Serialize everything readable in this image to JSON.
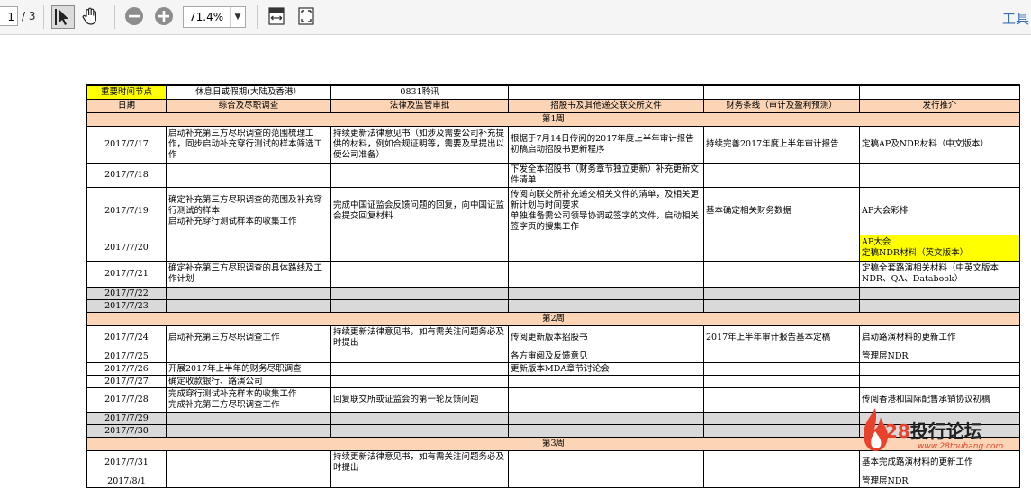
{
  "toolbar": {
    "page_current": "1",
    "page_total": "/ 3",
    "zoom": "71.4%",
    "tools": "工具",
    "icons": [
      "select-arrow-icon",
      "hand-icon",
      "zoom-out-icon",
      "zoom-in-icon",
      "fit-width-icon",
      "fit-page-icon"
    ]
  },
  "sheet": {
    "top": {
      "key_dates_label": "重要时间节点",
      "holiday": "休息日或假期(大陆及香港）",
      "hearing": "0831聆讯"
    },
    "headers": [
      "日期",
      "综合及尽职调查",
      "法律及监管审批",
      "招股书及其他递交联交所文件",
      "财务条线（审计及盈利预测）",
      "发行推介"
    ],
    "weeks": [
      "第1周",
      "第2周",
      "第3周"
    ],
    "rows": [
      {
        "date": "2017/7/17",
        "c1": "启动补充第三方尽职调查的范围梳理工作，同步启动补充穿行测试的样本筛选工作",
        "c2": "持续更新法律意见书（如涉及需要公司补充提供的材料，例如合规证明等，需要及早提出以便公司准备）",
        "c3": "根据于7月14日传阅的2017年度上半年审计报告初稿启动招股书更新程序",
        "c4": "持续完善2017年度上半年审计报告",
        "c5": "定稿AP及NDR材料（中文版本）"
      },
      {
        "date": "2017/7/18",
        "c1": "",
        "c2": "",
        "c3": "下发全本招股书（财务章节独立更新）补充更新文件清单",
        "c4": "",
        "c5": ""
      },
      {
        "date": "2017/7/19",
        "c1": "确定补充第三方尽职调查的范围及补充穿行测试的样本\n启动补充穿行测试样本的收集工作",
        "c2": "完成中国证监会反馈问题的回复，向中国证监会提交回复材料",
        "c3": "传阅向联交所补充递交相关文件的清单，及相关更新计划与时间要求\n单独准备需公司领导协调或签字的文件，启动相关签字页的搜集工作",
        "c4": "基本确定相关财务数据",
        "c5": "AP大会彩排"
      },
      {
        "date": "2017/7/20",
        "c1": "",
        "c2": "",
        "c3": "",
        "c4": "",
        "c5": "AP大会\n定稿NDR材料（英文版本）"
      },
      {
        "date": "2017/7/21",
        "c1": "确定补充第三方尽职调查的具体路线及工作计划",
        "c2": "",
        "c3": "",
        "c4": "",
        "c5": "定稿全套路演相关材料（中英文版本NDR、QA、Databook）"
      },
      {
        "date": "2017/7/22",
        "c1": "",
        "c2": "",
        "c3": "",
        "c4": "",
        "c5": ""
      },
      {
        "date": "2017/7/23",
        "c1": "",
        "c2": "",
        "c3": "",
        "c4": "",
        "c5": ""
      },
      {
        "date": "2017/7/24",
        "c1": "启动补充第三方尽职调查工作",
        "c2": "持续更新法律意见书，如有需关注问题务必及时提出",
        "c3": "传阅更新版本招股书",
        "c4": "2017年上半年审计报告基本定稿",
        "c5": "启动路演材料的更新工作"
      },
      {
        "date": "2017/7/25",
        "c1": "",
        "c2": "",
        "c3": "各方审阅及反馈意见",
        "c4": "",
        "c5": "管理层NDR"
      },
      {
        "date": "2017/7/26",
        "c1": "开展2017年上半年的财务尽职调查",
        "c2": "",
        "c3": "更新版本MDA章节讨论会",
        "c4": "",
        "c5": ""
      },
      {
        "date": "2017/7/27",
        "c1": "确定收款银行、路演公司",
        "c2": "",
        "c3": "",
        "c4": "",
        "c5": ""
      },
      {
        "date": "2017/7/28",
        "c1": "完成穿行测试补充样本的收集工作\n完成补充第三方尽职调查工作",
        "c2": "回复联交所或证监会的第一轮反馈问题",
        "c3": "",
        "c4": "",
        "c5": "传阅香港和国际配售承销协议初稿"
      },
      {
        "date": "2017/7/29",
        "c1": "",
        "c2": "",
        "c3": "",
        "c4": "",
        "c5": ""
      },
      {
        "date": "2017/7/30",
        "c1": "",
        "c2": "",
        "c3": "",
        "c4": "",
        "c5": ""
      },
      {
        "date": "2017/7/31",
        "c1": "",
        "c2": "持续更新法律意见书，如有需关注问题务必及时提出",
        "c3": "",
        "c4": "",
        "c5": "基本完成路演材料的更新工作"
      },
      {
        "date": "2017/8/1",
        "c1": "",
        "c2": "",
        "c3": "",
        "c4": "",
        "c5": "管理层NDR"
      }
    ]
  },
  "watermark": {
    "number": "28",
    "name": "投行论坛",
    "url": "www.28touhang.com"
  },
  "colors": {
    "week_band": "#fbd5b5",
    "highlight": "#ffff00",
    "weekend": "#d9d9d9",
    "logo": "#e8412c"
  }
}
